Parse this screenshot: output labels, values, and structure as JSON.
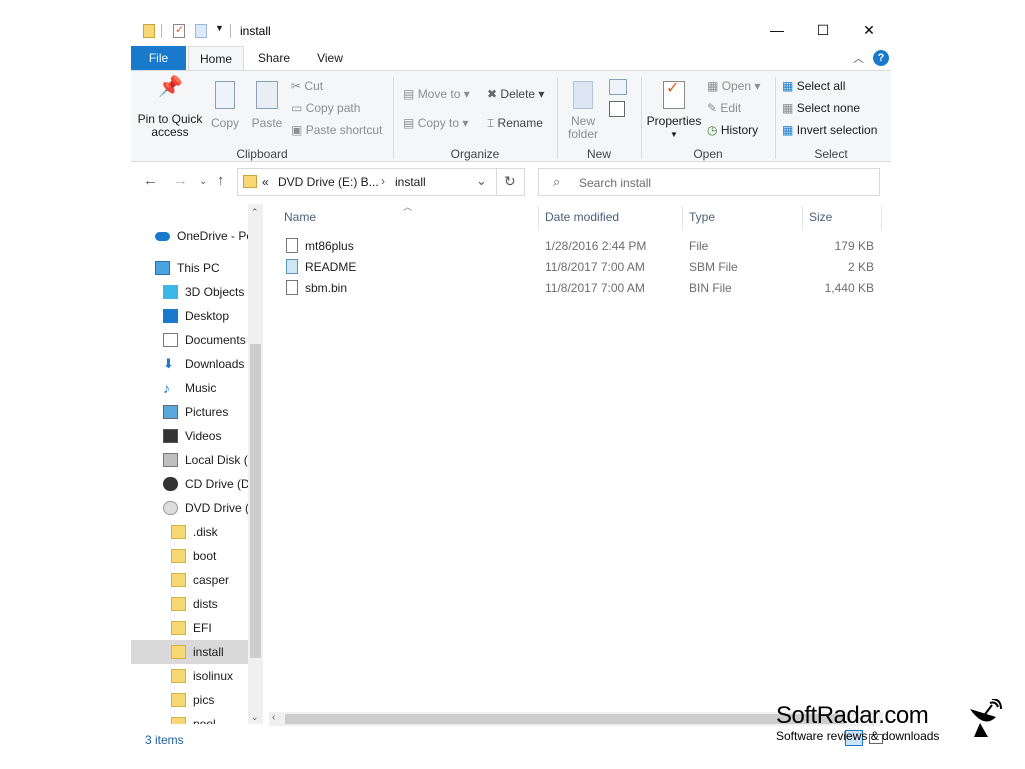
{
  "window": {
    "title": "install",
    "controls": {
      "minimize": "—",
      "maximize": "☐",
      "close": "✕"
    }
  },
  "ribbon": {
    "tabs": [
      "File",
      "Home",
      "Share",
      "View"
    ],
    "clipboard": {
      "pin": "Pin to Quick access",
      "pin_line1": "Pin to Quick",
      "pin_line2": "access",
      "copy": "Copy",
      "paste": "Paste",
      "cut": "Cut",
      "copy_path": "Copy path",
      "paste_shortcut": "Paste shortcut",
      "label": "Clipboard"
    },
    "organize": {
      "move_to": "Move to",
      "copy_to": "Copy to",
      "delete": "Delete",
      "rename": "Rename",
      "label": "Organize"
    },
    "new": {
      "new_folder_line1": "New",
      "new_folder_line2": "folder",
      "label": "New"
    },
    "open": {
      "properties": "Properties",
      "open": "Open",
      "edit": "Edit",
      "history": "History",
      "label": "Open"
    },
    "select": {
      "select_all": "Select all",
      "select_none": "Select none",
      "invert_selection": "Invert selection",
      "label": "Select"
    }
  },
  "address": {
    "prefix": "«",
    "crumb1": "DVD Drive (E:) B...",
    "crumb2": "install",
    "search_placeholder": "Search install"
  },
  "nav": [
    {
      "label": "OneDrive - Pe",
      "icon": "cloud-icon",
      "indent": 0
    },
    {
      "label": "This PC",
      "icon": "pc-icon",
      "indent": 0
    },
    {
      "label": "3D Objects",
      "icon": "cube-icon",
      "indent": 1
    },
    {
      "label": "Desktop",
      "icon": "desktop-icon",
      "indent": 1
    },
    {
      "label": "Documents",
      "icon": "document-icon",
      "indent": 1
    },
    {
      "label": "Downloads",
      "icon": "download-icon",
      "indent": 1
    },
    {
      "label": "Music",
      "icon": "music-icon",
      "indent": 1
    },
    {
      "label": "Pictures",
      "icon": "pictures-icon",
      "indent": 1
    },
    {
      "label": "Videos",
      "icon": "video-icon",
      "indent": 1
    },
    {
      "label": "Local Disk (",
      "icon": "disk-icon",
      "indent": 1
    },
    {
      "label": "CD Drive (D",
      "icon": "cd-icon",
      "indent": 1
    },
    {
      "label": "DVD Drive (I",
      "icon": "dvd-icon",
      "indent": 1
    },
    {
      "label": ".disk",
      "icon": "folder-icon",
      "indent": 2
    },
    {
      "label": "boot",
      "icon": "folder-icon",
      "indent": 2
    },
    {
      "label": "casper",
      "icon": "folder-icon",
      "indent": 2
    },
    {
      "label": "dists",
      "icon": "folder-icon",
      "indent": 2
    },
    {
      "label": "EFI",
      "icon": "folder-icon",
      "indent": 2
    },
    {
      "label": "install",
      "icon": "folder-icon",
      "indent": 2,
      "selected": true
    },
    {
      "label": "isolinux",
      "icon": "folder-icon",
      "indent": 2
    },
    {
      "label": "pics",
      "icon": "folder-icon",
      "indent": 2
    },
    {
      "label": "pool",
      "icon": "folder-icon",
      "indent": 2
    }
  ],
  "columns": {
    "name": "Name",
    "date": "Date modified",
    "type": "Type",
    "size": "Size"
  },
  "files": [
    {
      "name": "mt86plus",
      "date": "1/28/2016 2:44 PM",
      "type": "File",
      "size": "179 KB"
    },
    {
      "name": "README",
      "date": "11/8/2017 7:00 AM",
      "type": "SBM File",
      "size": "2 KB"
    },
    {
      "name": "sbm.bin",
      "date": "11/8/2017 7:00 AM",
      "type": "BIN File",
      "size": "1,440 KB"
    }
  ],
  "status": {
    "count": "3 items"
  },
  "watermark": {
    "brand": "SoftRadar.com",
    "tagline": "Software reviews & downloads"
  },
  "colors": {
    "accent": "#1979ca",
    "selected_nav": "#d9d9d9",
    "folder": "#f8d775"
  }
}
